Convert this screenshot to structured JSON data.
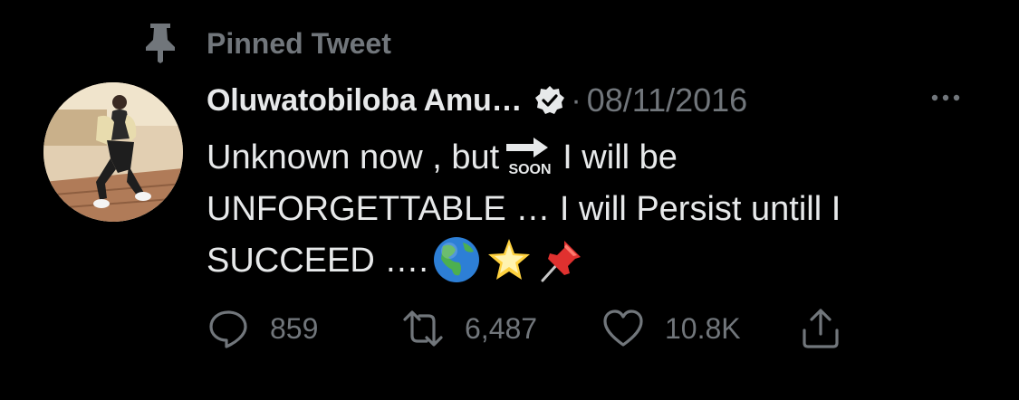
{
  "pinned": {
    "icon": "pin-icon",
    "label": "Pinned Tweet"
  },
  "tweet": {
    "author_name": "Oluwatobiloba Amu…",
    "verified": true,
    "separator": "·",
    "date": "08/11/2016",
    "text_part1": "Unknown now , but",
    "text_part2": "I will be UNFORGETTABLE … I will Persist untill I SUCCEED ….",
    "inline_icons": [
      "soon-arrow-icon",
      "globe-americas-icon",
      "glowing-star-icon",
      "pushpin-icon"
    ]
  },
  "actions": {
    "replies": {
      "icon": "reply-icon",
      "count": "859"
    },
    "retweets": {
      "icon": "retweet-icon",
      "count": "6,487"
    },
    "likes": {
      "icon": "like-icon",
      "count": "10.8K"
    },
    "share": {
      "icon": "share-icon"
    }
  },
  "colors": {
    "background": "#000000",
    "text": "#e7e9ea",
    "muted": "#71767b"
  }
}
